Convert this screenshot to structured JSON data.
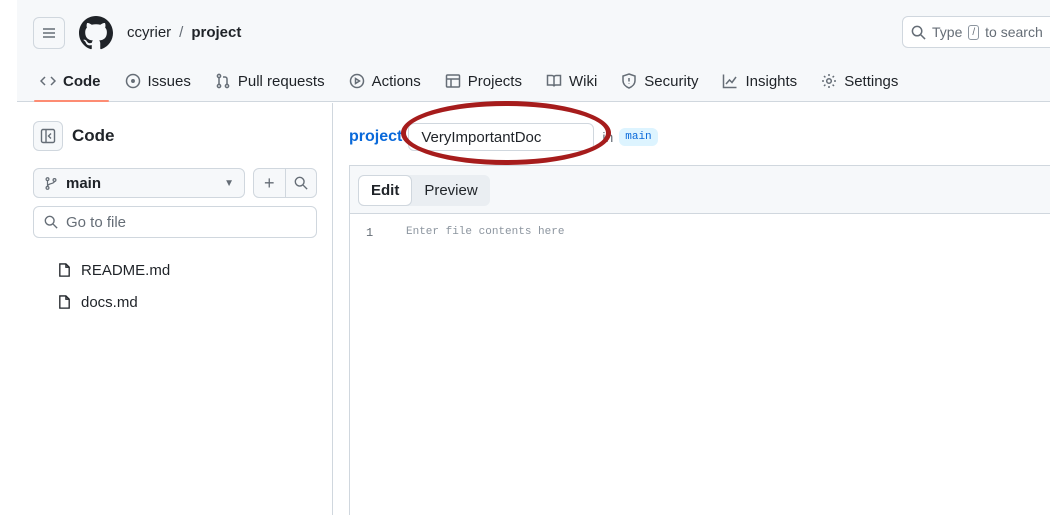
{
  "header": {
    "owner": "ccyrier",
    "separator": "/",
    "repo": "project",
    "search": {
      "prefix": "Type",
      "key": "/",
      "suffix": "to search"
    }
  },
  "nav": [
    {
      "label": "Code",
      "icon": "code-icon",
      "active": true
    },
    {
      "label": "Issues",
      "icon": "issue-opened-icon"
    },
    {
      "label": "Pull requests",
      "icon": "git-pull-request-icon"
    },
    {
      "label": "Actions",
      "icon": "play-icon"
    },
    {
      "label": "Projects",
      "icon": "table-icon"
    },
    {
      "label": "Wiki",
      "icon": "book-icon"
    },
    {
      "label": "Security",
      "icon": "shield-icon"
    },
    {
      "label": "Insights",
      "icon": "graph-icon"
    },
    {
      "label": "Settings",
      "icon": "gear-icon"
    }
  ],
  "sidebar": {
    "title": "Code",
    "branch": "main",
    "goto_placeholder": "Go to file",
    "files": [
      "README.md",
      "docs.md"
    ]
  },
  "editor": {
    "repo_link": "project",
    "filename": "VeryImportantDoc",
    "in_text": "in",
    "branch": "main",
    "tabs": [
      "Edit",
      "Preview"
    ],
    "line_number": "1",
    "placeholder": "Enter file contents here"
  },
  "colors": {
    "accent": "#0969da",
    "nav_underline": "#fd8c73",
    "highlight_ellipse": "#a61c1c"
  }
}
